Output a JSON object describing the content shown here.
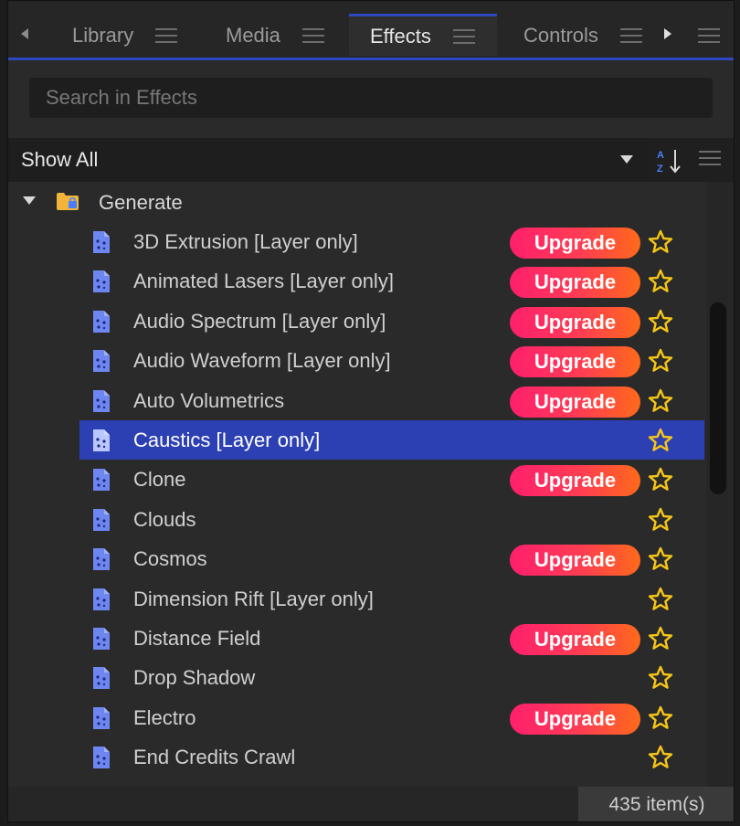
{
  "tabs": [
    {
      "label": "Library"
    },
    {
      "label": "Media"
    },
    {
      "label": "Effects"
    },
    {
      "label": "Controls"
    }
  ],
  "active_tab": "Effects",
  "search": {
    "placeholder": "Search in Effects",
    "value": ""
  },
  "filter": {
    "selected": "Show All"
  },
  "group": {
    "label": "Generate",
    "expanded": true
  },
  "items": [
    {
      "label": "3D Extrusion [Layer only]",
      "upgrade": "Upgrade"
    },
    {
      "label": "Animated Lasers [Layer only]",
      "upgrade": "Upgrade"
    },
    {
      "label": "Audio Spectrum [Layer only]",
      "upgrade": "Upgrade"
    },
    {
      "label": "Audio Waveform [Layer only]",
      "upgrade": "Upgrade"
    },
    {
      "label": "Auto Volumetrics",
      "upgrade": "Upgrade"
    },
    {
      "label": "Caustics [Layer only]",
      "upgrade": "",
      "selected": true
    },
    {
      "label": "Clone",
      "upgrade": "Upgrade"
    },
    {
      "label": "Clouds",
      "upgrade": ""
    },
    {
      "label": "Cosmos",
      "upgrade": "Upgrade"
    },
    {
      "label": "Dimension Rift [Layer only]",
      "upgrade": ""
    },
    {
      "label": "Distance Field",
      "upgrade": "Upgrade"
    },
    {
      "label": "Drop Shadow",
      "upgrade": ""
    },
    {
      "label": "Electro",
      "upgrade": "Upgrade"
    },
    {
      "label": "End Credits Crawl",
      "upgrade": ""
    }
  ],
  "status": {
    "count": "435 item(s)"
  },
  "colors": {
    "accent": "#2c49c2",
    "selected_row": "#2c40b3",
    "star": "#f5c518",
    "file_icon": "#6d86f0"
  }
}
